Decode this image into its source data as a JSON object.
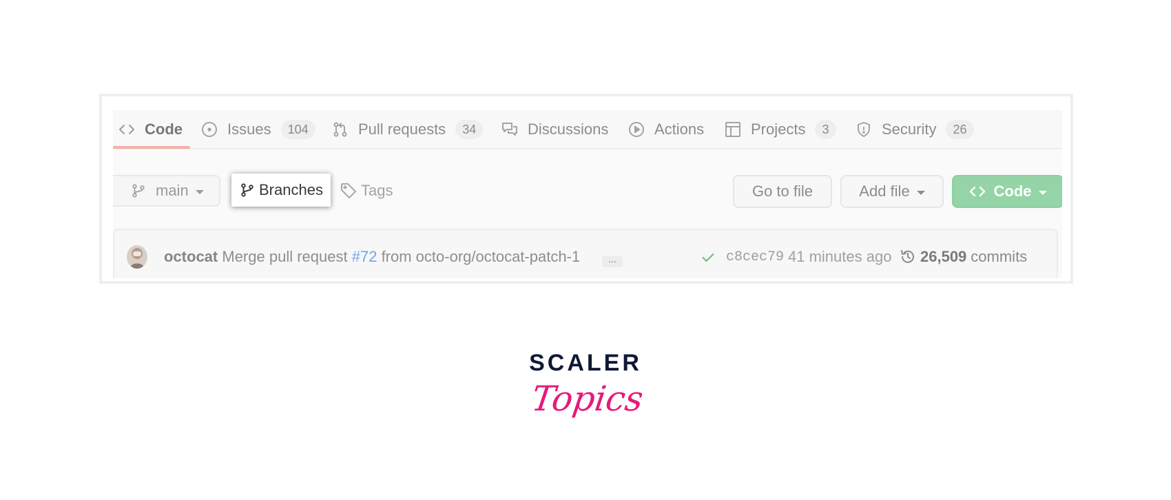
{
  "tabs": [
    {
      "label": "Code",
      "icon": "code-icon",
      "selected": true
    },
    {
      "label": "Issues",
      "icon": "issue-icon",
      "count": "104"
    },
    {
      "label": "Pull requests",
      "icon": "pull-request-icon",
      "count": "34"
    },
    {
      "label": "Discussions",
      "icon": "discussions-icon"
    },
    {
      "label": "Actions",
      "icon": "play-icon"
    },
    {
      "label": "Projects",
      "icon": "table-icon",
      "count": "3"
    },
    {
      "label": "Security",
      "icon": "shield-icon",
      "count": "26"
    }
  ],
  "branch_bar": {
    "branch": "main",
    "branches_label": "Branches",
    "tags_label": "Tags",
    "goto_file": "Go to file",
    "add_file": "Add file",
    "code": "Code"
  },
  "commit": {
    "author": "octocat",
    "message_prefix": "Merge pull request",
    "pr_number": "#72",
    "message_suffix": "from octo-org/octocat-patch-1",
    "ellipsis": "...",
    "sha": "c8cec79",
    "age": "41 minutes ago",
    "commit_count": "26,509",
    "commits_label": "commits"
  },
  "brand": {
    "scaler": "SCALER",
    "topics": "Topics",
    "scaler_color": "#0f1836",
    "topics_color": "#e6197b"
  },
  "colors": {
    "accent_green": "#94d4a6",
    "link_blue": "#6ea7e8",
    "tab_underline": "#f4b1a5"
  }
}
